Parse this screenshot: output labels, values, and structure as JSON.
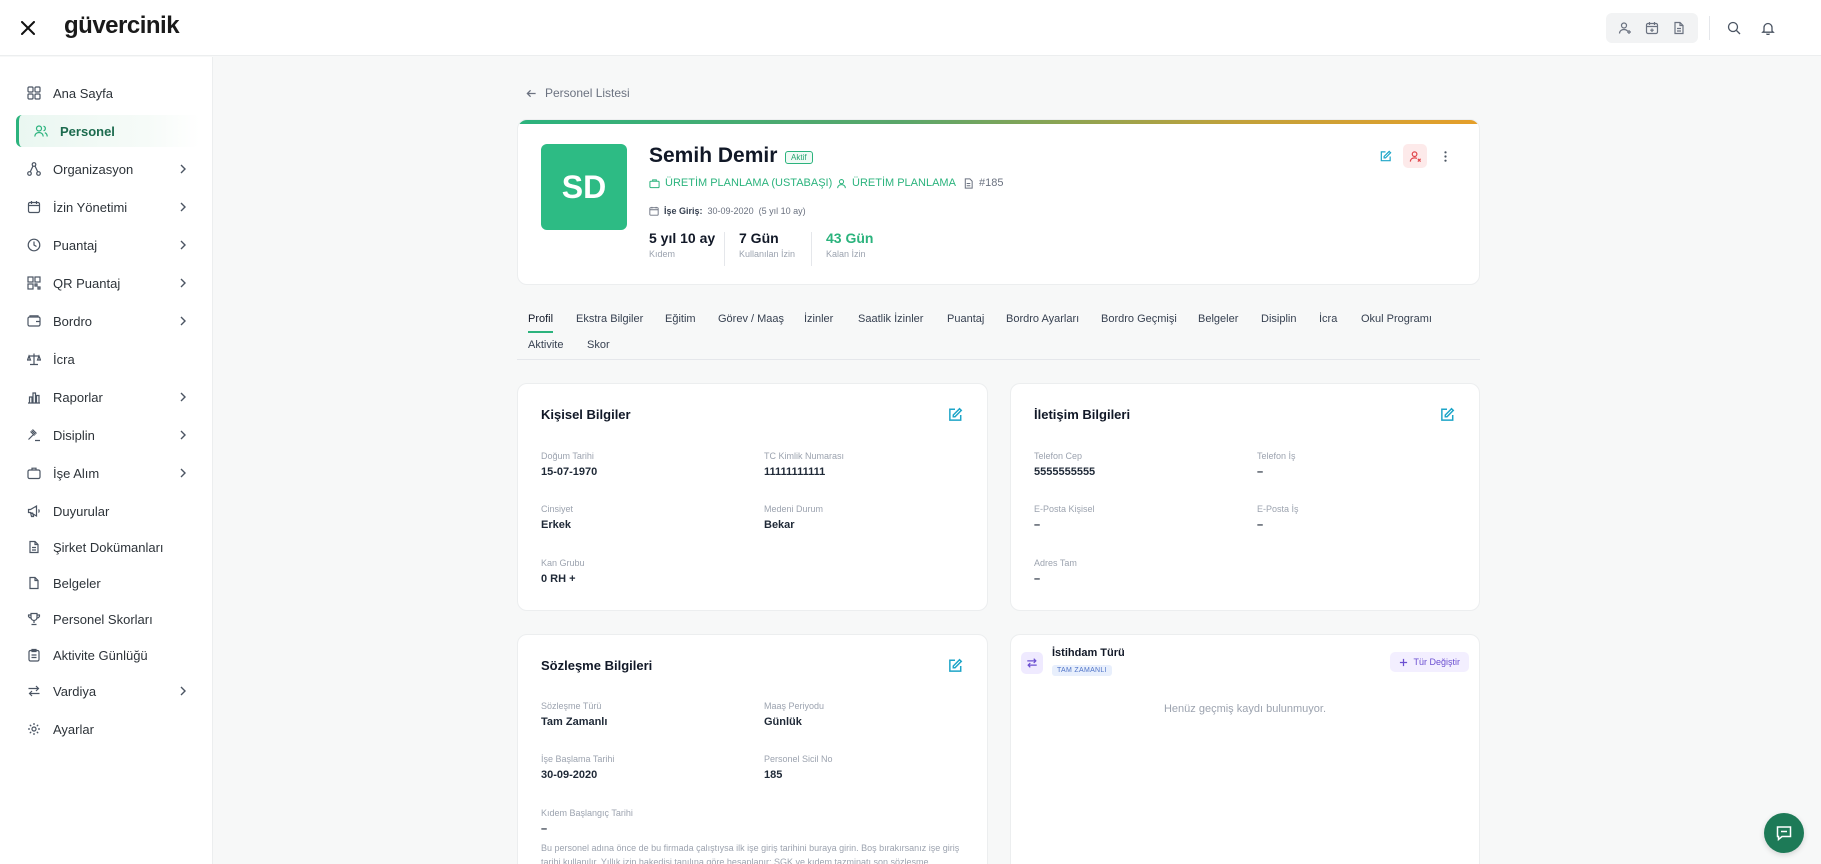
{
  "app": {
    "logo": "güvercinik"
  },
  "sidebar": {
    "items": [
      {
        "label": "Ana Sayfa",
        "icon": "grid-icon"
      },
      {
        "label": "Personel",
        "icon": "users-icon",
        "active": true
      },
      {
        "label": "Organizasyon",
        "icon": "org-chart-icon",
        "expandable": true
      },
      {
        "label": "İzin Yönetimi",
        "icon": "calendar-icon",
        "expandable": true
      },
      {
        "label": "Puantaj",
        "icon": "clock-icon",
        "expandable": true
      },
      {
        "label": "QR Puantaj",
        "icon": "qr-icon",
        "expandable": true
      },
      {
        "label": "Bordro",
        "icon": "wallet-icon",
        "expandable": true
      },
      {
        "label": "İcra",
        "icon": "scale-icon"
      },
      {
        "label": "Raporlar",
        "icon": "bar-chart-icon",
        "expandable": true
      },
      {
        "label": "Disiplin",
        "icon": "gavel-icon",
        "expandable": true
      },
      {
        "label": "İşe Alım",
        "icon": "briefcase-icon",
        "expandable": true
      },
      {
        "label": "Duyurular",
        "icon": "megaphone-icon"
      },
      {
        "label": "Şirket Dokümanları",
        "icon": "document-icon"
      },
      {
        "label": "Belgeler",
        "icon": "file-icon"
      },
      {
        "label": "Personel Skorları",
        "icon": "trophy-icon"
      },
      {
        "label": "Aktivite Günlüğü",
        "icon": "clipboard-icon"
      },
      {
        "label": "Vardiya",
        "icon": "swap-icon",
        "expandable": true
      },
      {
        "label": "Ayarlar",
        "icon": "gear-icon"
      }
    ]
  },
  "breadcrumb": {
    "back_label": "Personel Listesi"
  },
  "profile": {
    "initials": "SD",
    "name": "Semih Demir",
    "status": "Aktif",
    "position": "ÜRETİM PLANLAMA (USTABAŞI)",
    "department": "ÜRETİM PLANLAMA",
    "id": "#185",
    "start_label": "İşe Giriş:",
    "start_date": "30-09-2020",
    "start_duration": "(5 yıl 10 ay)",
    "stats": [
      {
        "value": "5 yıl 10 ay",
        "label": "Kıdem"
      },
      {
        "value": "7 Gün",
        "label": "Kullanılan İzin"
      },
      {
        "value": "43 Gün",
        "label": "Kalan İzin"
      }
    ]
  },
  "tabs": [
    "Profil",
    "Ekstra Bilgiler",
    "Eğitim",
    "Görev / Maaş",
    "İzinler",
    "Saatlik İzinler",
    "Puantaj",
    "Bordro Ayarları",
    "Bordro Geçmişi",
    "Belgeler",
    "Disiplin",
    "İcra",
    "Okul Programı",
    "Aktivite",
    "Skor"
  ],
  "personal": {
    "title": "Kişisel Bilgiler",
    "fields": [
      {
        "label": "Doğum Tarihi",
        "value": "15-07-1970"
      },
      {
        "label": "TC Kimlik Numarası",
        "value": "11111111111"
      },
      {
        "label": "Cinsiyet",
        "value": "Erkek"
      },
      {
        "label": "Medeni Durum",
        "value": "Bekar"
      },
      {
        "label": "Kan Grubu",
        "value": "0 RH +"
      }
    ]
  },
  "contact": {
    "title": "İletişim Bilgileri",
    "fields": [
      {
        "label": "Telefon Cep",
        "value": "5555555555"
      },
      {
        "label": "Telefon İş",
        "value": "–"
      },
      {
        "label": "E-Posta Kişisel",
        "value": "–"
      },
      {
        "label": "E-Posta İş",
        "value": "–"
      },
      {
        "label": "Adres Tam",
        "value": "–"
      }
    ]
  },
  "contract": {
    "title": "Sözleşme Bilgileri",
    "fields": [
      {
        "label": "Sözleşme Türü",
        "value": "Tam Zamanlı"
      },
      {
        "label": "Maaş Periyodu",
        "value": "Günlük"
      },
      {
        "label": "İşe Başlama Tarihi",
        "value": "30-09-2020"
      },
      {
        "label": "Personel Sicil No",
        "value": "185"
      },
      {
        "label": "Kıdem Başlangıç Tarihi",
        "value": "–"
      }
    ],
    "note": "Bu personel adına önce de bu firmada çalıştıysa ilk işe giriş tarihini buraya girin. Boş bırakırsanız işe giriş tarihi kullanılır. Yıllık izin hakedişi tanılına göre hesaplanır; SGK ve kıdem tazminatı son sözleşme"
  },
  "employment": {
    "title": "İstihdam Türü",
    "badge": "TAM ZAMANLI",
    "change_button": "Tür Değiştir",
    "empty_text": "Henüz geçmiş kaydı bulunmuyor."
  },
  "colors": {
    "accent": "#2bb37d",
    "avatar": "#2dbb84",
    "chat": "#1d7a57"
  }
}
